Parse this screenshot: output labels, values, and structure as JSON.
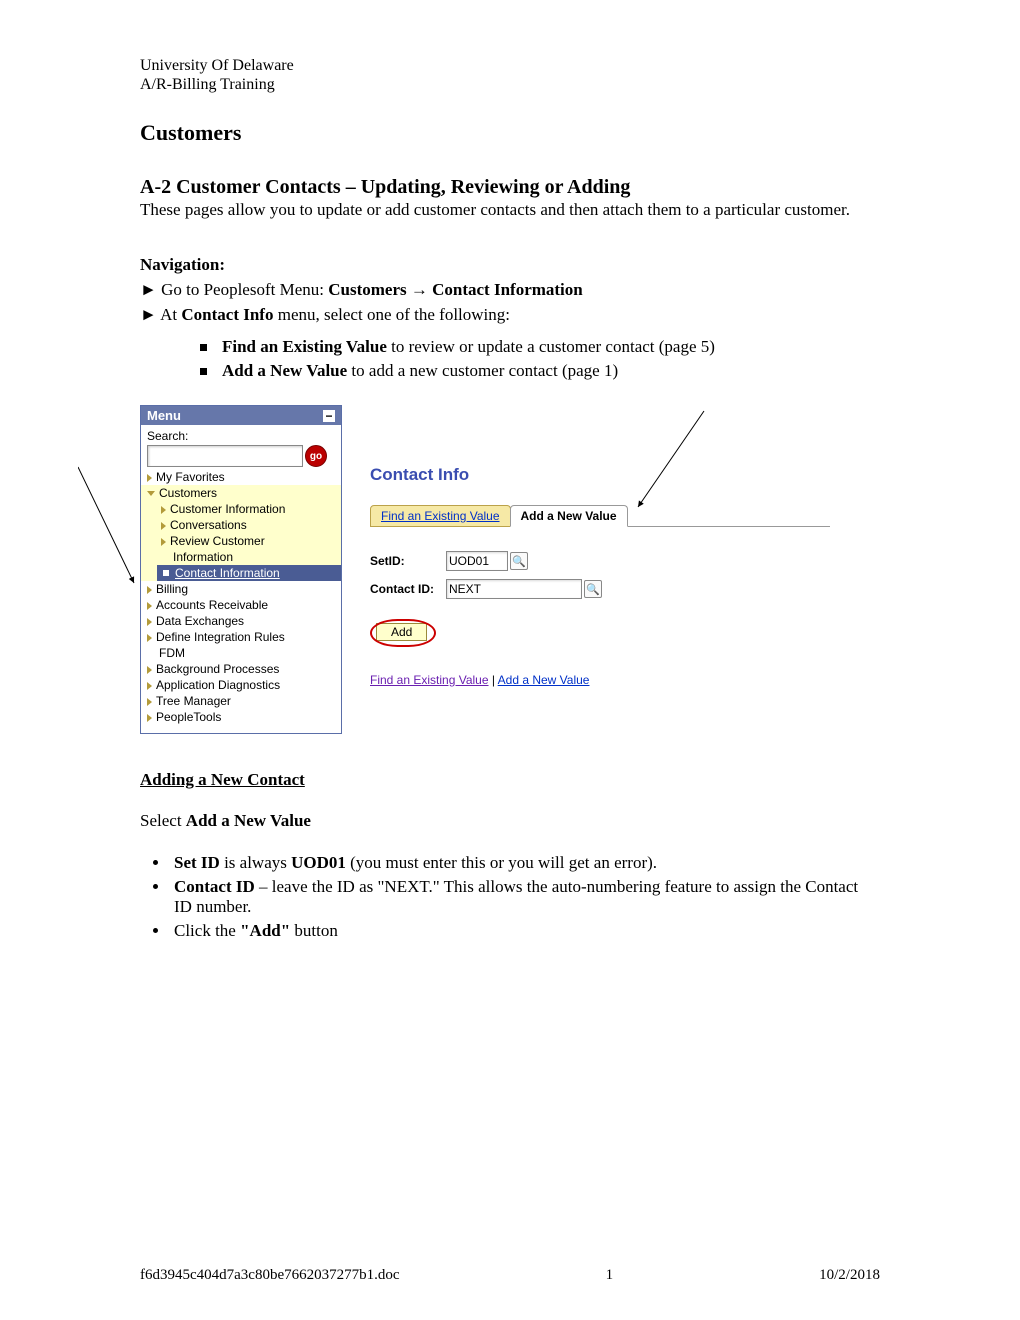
{
  "header": {
    "org": "University Of Delaware",
    "course": "A/R-Billing Training"
  },
  "title1": "Customers",
  "title2": "A-2  Customer Contacts – Updating, Reviewing or Adding",
  "intro": "These pages allow you to update or add customer contacts and then attach them to a particular customer.",
  "nav": {
    "label": "Navigation:",
    "line1_a": "► Go to Peoplesoft Menu: ",
    "line1_b": "Customers → Contact Information",
    "line2_a": "► At ",
    "line2_b": "Contact Info",
    "line2_c": " menu, select one of the following:"
  },
  "options": {
    "find_b": "Find an Existing Value",
    "find_t": " to review or update a customer contact (page 5)",
    "add_b": "Add a New Value",
    "add_t": " to add a new customer contact (page 1)"
  },
  "menu": {
    "title": "Menu",
    "collapse": "−",
    "search_label": "Search:",
    "go": "go",
    "items": {
      "fav": "My Favorites",
      "cust": "Customers",
      "ci": "Customer Information",
      "conv": "Conversations",
      "rev1": "Review Customer",
      "rev2": "Information",
      "contact": "Contact Information",
      "bill": "Billing",
      "ar": "Accounts Receivable",
      "dx": "Data Exchanges",
      "dir1": "Define Integration Rules",
      "dir2": "FDM",
      "bg": "Background Processes",
      "ad": "Application Diagnostics",
      "tm": "Tree Manager",
      "pt": "PeopleTools"
    }
  },
  "panel": {
    "title": "Contact Info",
    "tab_find": "Find an Existing Value",
    "tab_add": "Add a New Value",
    "setid_label": "SetID:",
    "setid_value": "UOD01",
    "contactid_label": "Contact ID:",
    "contactid_value": "NEXT",
    "add_btn": "Add",
    "bl_find": "Find an Existing Value",
    "bl_sep": " | ",
    "bl_add": "Add a New Value"
  },
  "section2": {
    "heading": "Adding a New Contact",
    "select_a": "Select ",
    "select_b": "Add a New Value",
    "b1_a": "Set ID",
    "b1_b": " is always ",
    "b1_c": "UOD01",
    "b1_d": " (you must enter this or you will get an error).",
    "b2_a": "Contact ID",
    "b2_b": " – leave the ID as \"NEXT.\" This allows the auto-numbering feature to assign the Contact ID number.",
    "b3_a": "Click the ",
    "b3_b": "\"Add\"",
    "b3_c": " button"
  },
  "footer": {
    "file": "f6d3945c404d7a3c80be7662037277b1.doc",
    "page": "1",
    "date": "10/2/2018"
  }
}
